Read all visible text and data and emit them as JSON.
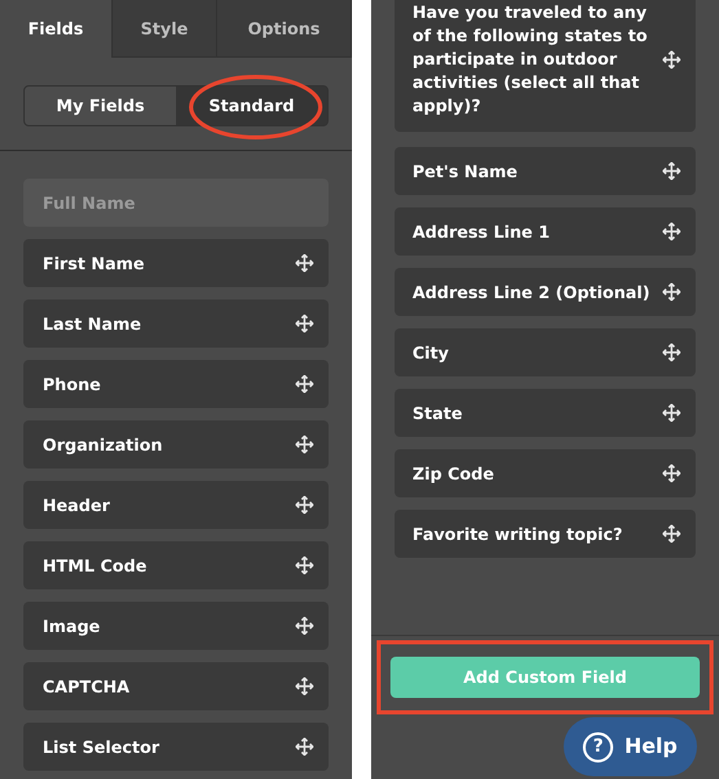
{
  "tabs": [
    {
      "label": "Fields",
      "selected": true
    },
    {
      "label": "Style",
      "selected": false
    },
    {
      "label": "Options",
      "selected": false
    }
  ],
  "segments": [
    {
      "label": "My Fields",
      "selected": false
    },
    {
      "label": "Standard",
      "selected": true
    }
  ],
  "standard_fields": [
    {
      "label": "Full Name",
      "disabled": true
    },
    {
      "label": "First Name",
      "disabled": false
    },
    {
      "label": "Last Name",
      "disabled": false
    },
    {
      "label": "Phone",
      "disabled": false
    },
    {
      "label": "Organization",
      "disabled": false
    },
    {
      "label": "Header",
      "disabled": false
    },
    {
      "label": "HTML Code",
      "disabled": false
    },
    {
      "label": "Image",
      "disabled": false
    },
    {
      "label": "CAPTCHA",
      "disabled": false
    },
    {
      "label": "List Selector",
      "disabled": false
    }
  ],
  "my_fields": [
    {
      "label": "Have you traveled to any of the following states to participate in outdoor activities (select all that apply)?"
    },
    {
      "label": "Pet's Name"
    },
    {
      "label": "Address Line 1"
    },
    {
      "label": "Address Line 2 (Optional)"
    },
    {
      "label": "City"
    },
    {
      "label": "State"
    },
    {
      "label": "Zip Code"
    },
    {
      "label": "Favorite writing topic?"
    }
  ],
  "add_button": "Add Custom Field",
  "help_button": {
    "icon": "?",
    "label": "Help"
  }
}
